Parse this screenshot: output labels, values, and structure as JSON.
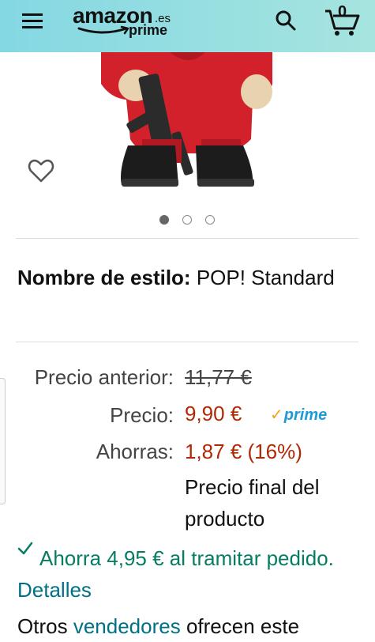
{
  "header": {
    "logo_word": "amazon",
    "logo_tld": ".es",
    "logo_prime": "prime",
    "cart_count": "0"
  },
  "product": {
    "image_alt": "Funko POP figure in red jumpsuit with black boots",
    "carousel_dots": 3,
    "carousel_active": 0
  },
  "style": {
    "label": "Nombre de estilo:",
    "value": "POP! Standard"
  },
  "pricing": {
    "previous_label": "Precio anterior:",
    "previous_value": "11,77 €",
    "price_label": "Precio:",
    "price_value": "9,90 €",
    "prime_badge": "prime",
    "savings_label": "Ahorras:",
    "savings_value": "1,87 € (16%)",
    "final_note": "Precio final del producto"
  },
  "promo": {
    "text": "Ahorra 4,95 € al tramitar pedido.",
    "link": "Detalles"
  },
  "other_sellers": {
    "prefix": "Otros",
    "link": "vendedores",
    "suffix": "ofrecen este"
  },
  "colors": {
    "header_bg_start": "#84d8e3",
    "header_bg_end": "#a6e4df",
    "price_red": "#b12704",
    "promo_green": "#067d62",
    "link_teal": "#007185",
    "prime_blue": "#1e9bd7"
  }
}
